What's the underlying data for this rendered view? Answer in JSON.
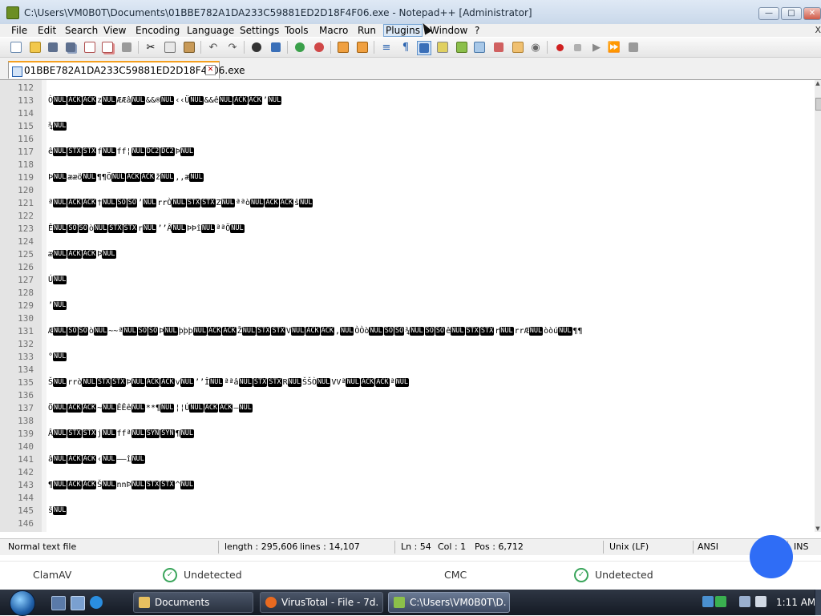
{
  "window": {
    "title": "C:\\Users\\VM0B0T\\Documents\\01BBE782A1DA233C59881ED2D18F4F06.exe - Notepad++ [Administrator]",
    "minimize_glyph": "—",
    "maximize_glyph": "□",
    "close_glyph": "✕"
  },
  "menu": {
    "items": [
      "File",
      "Edit",
      "Search",
      "View",
      "Encoding",
      "Language",
      "Settings",
      "Tools",
      "Macro",
      "Run",
      "Plugins",
      "Window",
      "?"
    ],
    "close_glyph": "X"
  },
  "toolbar": {
    "icons": [
      "new-file",
      "open-file",
      "save",
      "save-all",
      "close",
      "close-all",
      "print",
      "cut",
      "copy",
      "paste",
      "undo",
      "redo",
      "find",
      "replace",
      "zoom-in",
      "zoom-out",
      "sync-vertical",
      "sync-horizontal",
      "word-wrap",
      "show-all-characters",
      "indent-guide",
      "user-defined-language",
      "document-map",
      "function-list",
      "folder-as-workspace",
      "monitoring",
      "record-macro",
      "stop-recording",
      "playback-macro",
      "run-macro-multiple",
      "save-macro"
    ]
  },
  "tab": {
    "label": "01BBE782A1DA233C59881ED2D18F4F06.exe",
    "close_glyph": "✕"
  },
  "editor": {
    "lines": [
      {
        "n": "112",
        "segs": []
      },
      {
        "n": "113",
        "segs": [
          "Ò",
          "#NUL",
          "#ACK",
          "#ACK",
          "z",
          "#NUL",
          "ÆÆâ",
          "#NUL",
          "&&®",
          "#NUL",
          "‹‹Ü",
          "#NUL",
          "&&ê",
          "#NUL",
          "#ACK",
          "#ACK",
          "’",
          "#NUL"
        ]
      },
      {
        "n": "114",
        "segs": []
      },
      {
        "n": "115",
        "segs": [
          "¾",
          "#NUL"
        ]
      },
      {
        "n": "116",
        "segs": []
      },
      {
        "n": "117",
        "segs": [
          "ê",
          "#NUL",
          "#STX",
          "#STX",
          "f",
          "#NUL",
          "ff¦",
          "#NUL",
          "#DC2",
          "#DC2",
          "Þ",
          "#NUL"
        ]
      },
      {
        "n": "118",
        "segs": []
      },
      {
        "n": "119",
        "segs": [
          "Þ",
          "#NUL",
          "ææö",
          "#NUL",
          "¶¶Ö",
          "#NUL",
          "#ACK",
          "#ACK",
          "ž",
          "#NUL",
          ",,æ",
          "#NUL"
        ]
      },
      {
        "n": "120",
        "segs": []
      },
      {
        "n": "121",
        "segs": [
          "ª",
          "#NUL",
          "#ACK",
          "#ACK",
          "†",
          "#NUL",
          "#SO",
          "#SO",
          "’",
          "#NUL",
          "rrÒ",
          "#NUL",
          "#STX",
          "#STX",
          "Z",
          "#NUL",
          "ªªò",
          "#NUL",
          "#ACK",
          "#ACK",
          "ŝ",
          "#NUL"
        ]
      },
      {
        "n": "122",
        "segs": []
      },
      {
        "n": "123",
        "segs": [
          "Ê",
          "#NUL",
          "#SO",
          "#SO",
          "ò",
          "#NUL",
          "#STX",
          "#STX",
          "r",
          "#NUL",
          "’’Â",
          "#NUL",
          "ÞÞî",
          "#NUL",
          "ªªÖ",
          "#NUL"
        ]
      },
      {
        "n": "124",
        "segs": []
      },
      {
        "n": "125",
        "segs": [
          "æ",
          "#NUL",
          "#ACK",
          "#ACK",
          "Þ",
          "#NUL"
        ]
      },
      {
        "n": "126",
        "segs": []
      },
      {
        "n": "127",
        "segs": [
          "Ú",
          "#NUL"
        ]
      },
      {
        "n": "128",
        "segs": []
      },
      {
        "n": "129",
        "segs": [
          "’",
          "#NUL"
        ]
      },
      {
        "n": "130",
        "segs": []
      },
      {
        "n": "131",
        "segs": [
          "Æ",
          "#NUL",
          "#SO",
          "#SO",
          "ò",
          "#NUL",
          "~~ª",
          "#NUL",
          "#SO",
          "#SO",
          "Þ",
          "#NUL",
          "þþþ",
          "#NUL",
          "#ACK",
          "#ACK",
          "Ž",
          "#NUL",
          "#STX",
          "#STX",
          "V",
          "#NUL",
          "#ACK",
          "#ACK",
          ",",
          "#NUL",
          "ÒÒò",
          "#NUL",
          "#SO",
          "#SO",
          "¾",
          "#NUL",
          "#SO",
          "#SO",
          "ê",
          "#NUL",
          "#STX",
          "#STX",
          "r",
          "#NUL",
          "rrÆ",
          "#NUL",
          "òòú",
          "#NUL",
          "¶¶"
        ]
      },
      {
        "n": "132",
        "segs": []
      },
      {
        "n": "133",
        "segs": [
          "°",
          "#NUL"
        ]
      },
      {
        "n": "134",
        "segs": []
      },
      {
        "n": "135",
        "segs": [
          "Š",
          "#NUL",
          "rrò",
          "#NUL",
          "#STX",
          "#STX",
          "Þ",
          "#NUL",
          "#ACK",
          "#ACK",
          "v",
          "#NUL",
          "’’Î",
          "#NUL",
          "ªªâ",
          "#NUL",
          "#STX",
          "#STX",
          "R",
          "#NUL",
          "ŠŠÒ",
          "#NUL",
          "VVª",
          "#NUL",
          "#ACK",
          "#ACK",
          "ª",
          "#NUL"
        ]
      },
      {
        "n": "136",
        "segs": []
      },
      {
        "n": "137",
        "segs": [
          "Ö",
          "#NUL",
          "#ACK",
          "#ACK",
          "~",
          "#NUL",
          "ÊÊê",
          "#NUL",
          "**¶",
          "#NUL",
          "¦¦Ú",
          "#NUL",
          "#ACK",
          "#ACK",
          "–",
          "#NUL"
        ]
      },
      {
        "n": "138",
        "segs": []
      },
      {
        "n": "139",
        "segs": [
          "Â",
          "#NUL",
          "#STX",
          "#STX",
          "j",
          "#NUL",
          "ffª",
          "#NUL",
          "#SYN",
          "#SYN",
          "¶",
          "#NUL"
        ]
      },
      {
        "n": "140",
        "segs": []
      },
      {
        "n": "141",
        "segs": [
          "â",
          "#NUL",
          "#ACK",
          "#ACK",
          "‹",
          "#NUL",
          "––î",
          "#NUL"
        ]
      },
      {
        "n": "142",
        "segs": []
      },
      {
        "n": "143",
        "segs": [
          "¶",
          "#NUL",
          "#ACK",
          "#ACK",
          "Š",
          "#NUL",
          "nnÞ",
          "#NUL",
          "#STX",
          "#STX",
          "^",
          "#NUL"
        ]
      },
      {
        "n": "144",
        "segs": []
      },
      {
        "n": "145",
        "segs": [
          "š",
          "#NUL"
        ]
      },
      {
        "n": "146",
        "segs": []
      }
    ]
  },
  "status": {
    "doc_type": "Normal text file",
    "length": "length : 295,606",
    "lines": "lines : 14,107",
    "ln": "Ln : 54",
    "col": "Col : 1",
    "pos": "Pos : 6,712",
    "eol": "Unix (LF)",
    "encoding": "ANSI",
    "mode": "INS"
  },
  "background_page": {
    "engine1": "ClamAV",
    "result1": "Undetected",
    "engine2": "CMC",
    "result2": "Undetected",
    "accent_color": "#2f6df6",
    "ok_color": "#3aa55b"
  },
  "taskbar": {
    "tasks": [
      {
        "label": "Documents",
        "icon": "folder-icon"
      },
      {
        "label": "VirusTotal - File - 7d...",
        "icon": "firefox-icon"
      },
      {
        "label": "C:\\Users\\VM0B0T\\D...",
        "icon": "notepadpp-icon"
      }
    ],
    "clock": "1:11 AM"
  }
}
